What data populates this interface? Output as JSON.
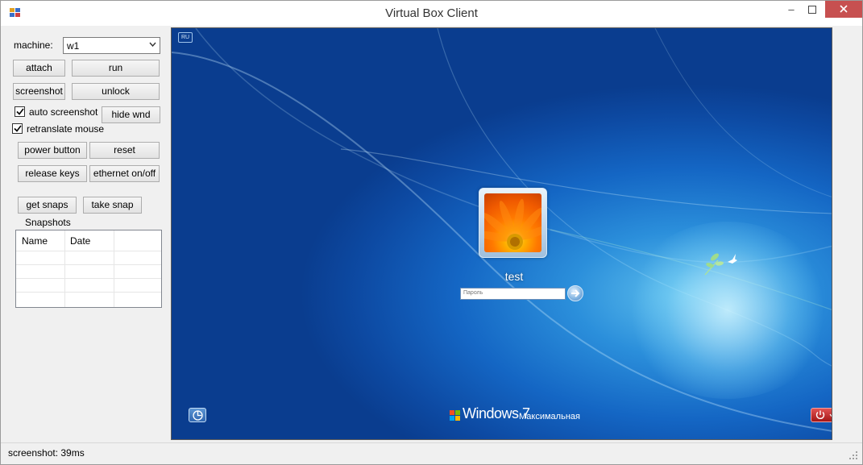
{
  "window": {
    "title": "Virtual Box Client"
  },
  "controls": {
    "machine_label": "machine:",
    "machine_value": "w1",
    "attach": "attach",
    "run": "run",
    "screenshot": "screenshot",
    "unlock": "unlock",
    "auto_screenshot": "auto screenshot",
    "hide_wnd": "hide wnd",
    "retranslate_mouse": "retranslate mouse",
    "power_button": "power button",
    "reset": "reset",
    "release_keys": "release keys",
    "ethernet": "ethernet on/off",
    "get_snaps": "get snaps",
    "take_snap": "take snap",
    "snapshots_label": "Snapshots"
  },
  "checkboxes": {
    "auto_screenshot_checked": true,
    "retranslate_mouse_checked": true
  },
  "snapshots": {
    "columns": [
      "Name",
      "Date"
    ],
    "rows": []
  },
  "vm_screen": {
    "lang_indicator": "RU",
    "username": "test",
    "password_placeholder": "Пароль",
    "os_brand": "Windows 7",
    "os_edition": "Максимальная"
  },
  "status": {
    "text": "screenshot: 39ms"
  },
  "icons": [
    "app-icon",
    "minimize-icon",
    "maximize-icon",
    "close-icon",
    "chevron-down-icon",
    "checkmark-icon",
    "arrow-right-icon",
    "ease-of-access-icon",
    "power-icon",
    "windows-logo-icon",
    "resize-grip-icon"
  ],
  "colors": {
    "close_button": "#c75050",
    "desktop_blue": "#1466c4",
    "power_red": "#c21f1f"
  }
}
